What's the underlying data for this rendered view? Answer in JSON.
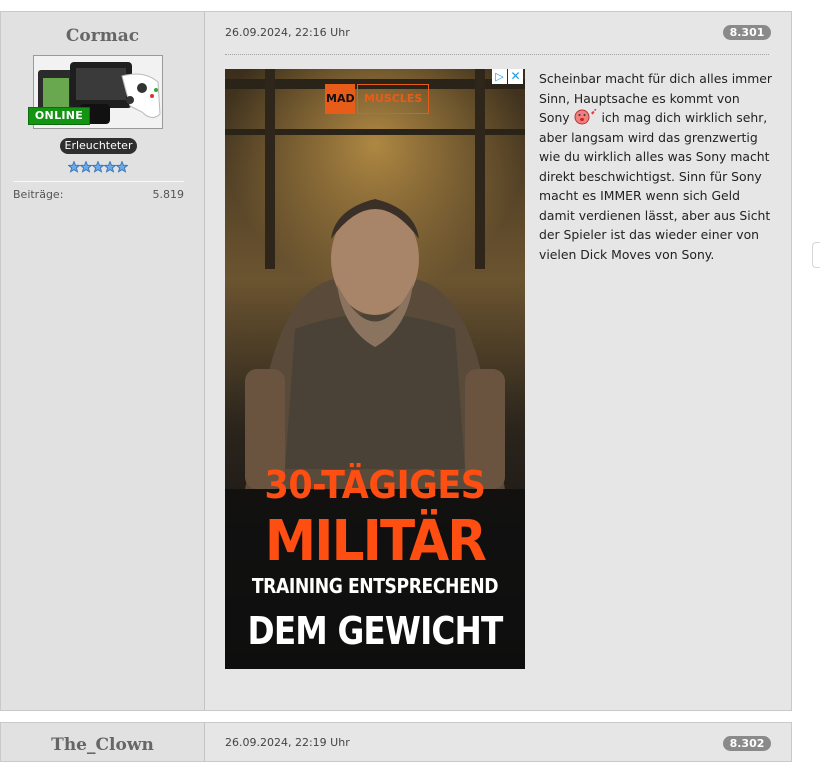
{
  "posts": [
    {
      "author": "Cormac",
      "online_label": "ONLINE",
      "rank": "Erleuchteter",
      "stars": 5,
      "stats_label": "Beiträge:",
      "stats_value": "5.819",
      "date": "26.09.2024, 22:16 Uhr",
      "post_number": "8.301",
      "text_parts": [
        "Scheinbar macht für dich alles immer Sinn, Hauptsache es kommt von Sony ",
        " ich mag dich wirklich sehr, aber langsam wird das grenzwertig wie du wirklich alles was Sony macht direkt beschwichtigst. Sinn für Sony macht es IMMER wenn sich Geld damit verdienen lässt, aber aus Sicht der Spieler ist das wieder einer von vielen Dick Moves von Sony."
      ],
      "smiley": "kiss-smiley-icon"
    },
    {
      "author": "The_Clown",
      "date": "26.09.2024, 22:19 Uhr",
      "post_number": "8.302"
    }
  ],
  "ad": {
    "brand_mark": "MAD",
    "brand_name": "MUSCLES",
    "info_glyph": "▷",
    "close_glyph": "✕",
    "headline_1": "30-TÄGIGES",
    "headline_2": "MILITÄR",
    "headline_3": "TRAINING ENTSPRECHEND",
    "headline_4": "DEM GEWICHT"
  },
  "colors": {
    "online": "#139413",
    "ad_accent": "#ff4e12",
    "post_bg": "#e6e6e6",
    "sidebar_bg": "#e1e1e1"
  }
}
